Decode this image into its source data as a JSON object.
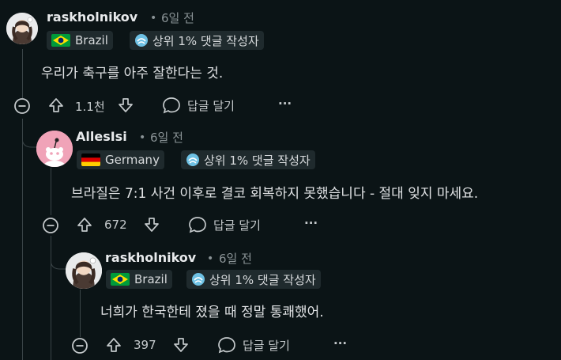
{
  "comments": [
    {
      "username": "raskholnikov",
      "separator": "•",
      "time": "6일 전",
      "country": "Brazil",
      "badge": "상위 1% 댓글 작성자",
      "body": "우리가 축구를 아주 잘한다는 것.",
      "votes": "1.1천",
      "reply_label": "답글 달기",
      "more_label": "···",
      "flag_icon": "brazil-flag-icon"
    },
    {
      "username": "AllesIsi",
      "separator": "•",
      "time": "6일 전",
      "country": "Germany",
      "badge": "상위 1% 댓글 작성자",
      "body": "브라질은 7:1 사건 이후로 결코 회복하지 못했습니다 - 절대 잊지 마세요.",
      "votes": "672",
      "reply_label": "답글 달기",
      "more_label": "···",
      "flag_icon": "germany-flag-icon"
    },
    {
      "username": "raskholnikov",
      "separator": "•",
      "time": "6일 전",
      "country": "Brazil",
      "badge": "상위 1% 댓글 작성자",
      "body": "너희가 한국한테 졌을 때 정말 통쾌했어.",
      "votes": "397",
      "reply_label": "답글 달기",
      "more_label": "···",
      "flag_icon": "brazil-flag-icon"
    }
  ],
  "colors": {
    "background": "#0b1416",
    "pink_avatar": "#f0a3b8",
    "badge_icon": "#6ec1e4"
  }
}
